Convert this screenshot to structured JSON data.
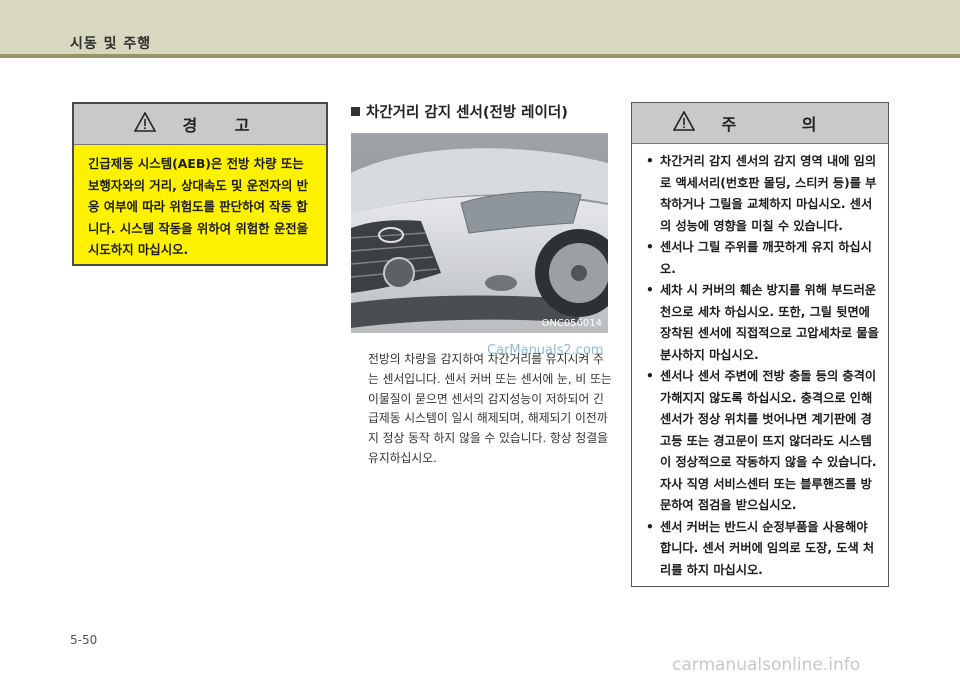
{
  "header": {
    "title": "시동 및 주행"
  },
  "warning": {
    "title": "경 고",
    "icon": "warning-triangle-icon",
    "text": "긴급제동 시스템(AEB)은 전방 차량 또는 보행자와의 거리, 상대속도 및 운전자의 반응 여부에 따라 위험도를 판단하여 작동 합니다. 시스템 작동을 위하여 위험한 운전을 시도하지 마십시오."
  },
  "section": {
    "title": "차간거리 감지 센서(전방 레이더)",
    "image_code": "ONC056014",
    "body": "전방의 차량을 감지하여 차간거리를 유지시켜 주는 센서입니다. 센서 커버 또는 센서에 눈, 비 또는 이물질이 묻으면 센서의 감지성능이 저하되어 긴급제동 시스템이 일시 해제되며, 해제되기 이전까지 정상 동작 하지 않을 수 있습니다. 항상 청결을 유지하십시오."
  },
  "caution": {
    "title": "주 의",
    "icon": "warning-triangle-icon",
    "items": [
      "차간거리 감지 센서의 감지 영역 내에 임의로 액세서리(번호판 몰딩, 스티커 등)를 부착하거나 그릴을 교체하지 마십시오. 센서의 성능에 영향을 미칠 수 있습니다.",
      "센서나 그릴 주위를 깨끗하게 유지 하십시오.",
      "세차 시 커버의 훼손 방지를 위해 부드러운 천으로 세차 하십시오. 또한, 그릴 뒷면에 장착된 센서에 직접적으로 고압세차로 물을 분사하지 마십시오.",
      "센서나 센서 주변에 전방 충돌 등의 충격이 가해지지 않도록 하십시오. 충격으로 인해 센서가 정상 위치를 벗어나면 계기판에 경고등 또는 경고문이 뜨지 않더라도 시스템이 정상적으로 작동하지 않을 수 있습니다. 자사 직영 서비스센터 또는 블루핸즈를 방문하여 점검을 받으십시오.",
      "센서 커버는 반드시 순정부품을 사용해야 합니다. 센서 커버에 임의로 도장, 도색 처리를 하지 마십시오."
    ]
  },
  "footer": {
    "page_number": "5-50"
  },
  "watermarks": {
    "top": "CarManuals2.com",
    "bottom": "carmanualsonline.info"
  }
}
